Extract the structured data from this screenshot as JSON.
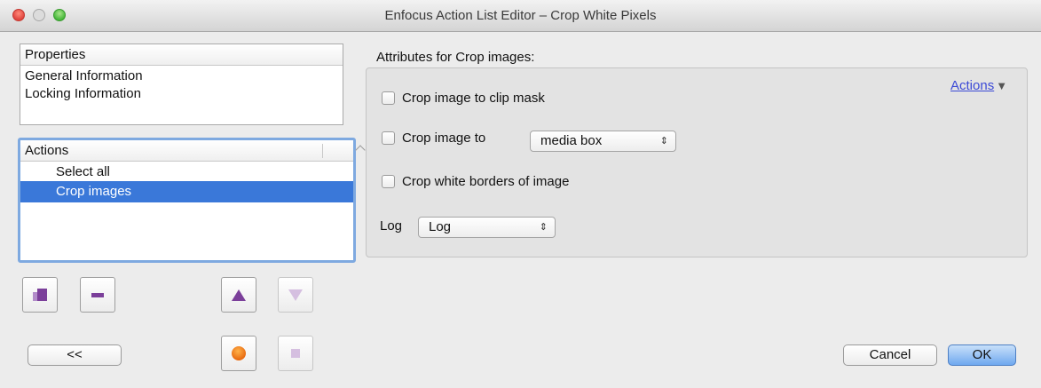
{
  "window": {
    "title": "Enfocus Action List Editor – Crop White Pixels"
  },
  "properties": {
    "header": "Properties",
    "items": [
      "General Information",
      "Locking Information"
    ]
  },
  "actions": {
    "header": "Actions",
    "items": [
      {
        "label": "Select all",
        "selected": false
      },
      {
        "label": "Crop images",
        "selected": true
      }
    ]
  },
  "attributes": {
    "title": "Attributes for Crop images:",
    "actions_menu": "Actions",
    "crop_clip_mask_label": "Crop image to clip mask",
    "crop_to_label": "Crop image to",
    "crop_to_value": "media box",
    "crop_white_label": "Crop white borders of image",
    "log_label": "Log",
    "log_value": "Log"
  },
  "buttons": {
    "collapse": "<<",
    "cancel": "Cancel",
    "ok": "OK"
  },
  "colors": {
    "selection": "#3a78d9",
    "focus_ring": "#7ea9e0",
    "icon_purple": "#7b3f9a",
    "link": "#3b49d6"
  }
}
